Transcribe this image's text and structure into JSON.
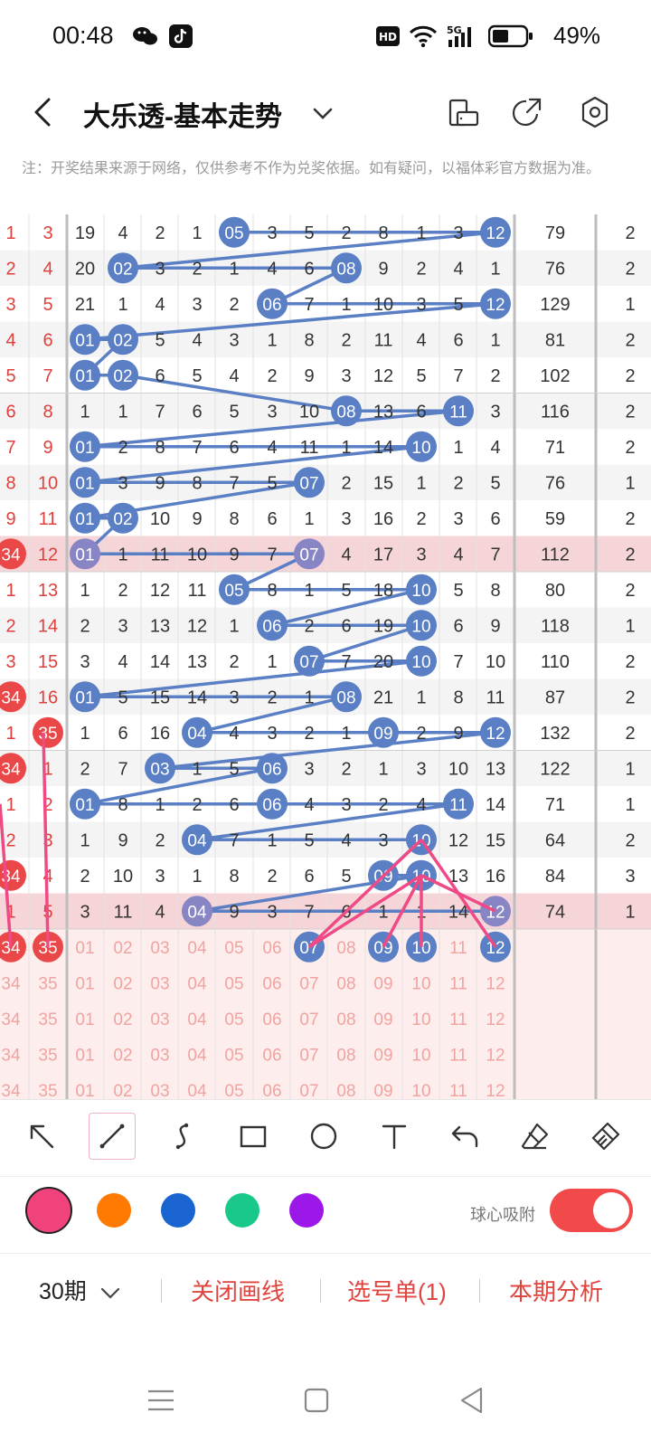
{
  "status": {
    "time": "00:48",
    "hd": "HD",
    "net": "5G",
    "battery": "49%"
  },
  "header": {
    "title": "大乐透-基本走势",
    "icons": [
      "chevron-down-icon",
      "phone-rotate-icon",
      "share-icon",
      "settings-icon"
    ]
  },
  "notice": "注：开奖结果来源于网络，仅供参考不作为兑奖依据。如有疑问，以福体彩官方数据为准。",
  "trend": {
    "rows": [
      [
        "1",
        "3",
        "19",
        "4",
        "2",
        "1",
        "05",
        "3",
        "5",
        "2",
        "8",
        "1",
        "3",
        "12",
        "79",
        "2"
      ],
      [
        "2",
        "4",
        "20",
        "02",
        "3",
        "2",
        "1",
        "4",
        "6",
        "08",
        "9",
        "2",
        "4",
        "1",
        "76",
        "2"
      ],
      [
        "3",
        "5",
        "21",
        "1",
        "4",
        "3",
        "2",
        "06",
        "7",
        "1",
        "10",
        "3",
        "5",
        "12",
        "129",
        "1"
      ],
      [
        "4",
        "6",
        "01",
        "02",
        "5",
        "4",
        "3",
        "1",
        "8",
        "2",
        "11",
        "4",
        "6",
        "1",
        "81",
        "2"
      ],
      [
        "5",
        "7",
        "01",
        "02",
        "6",
        "5",
        "4",
        "2",
        "9",
        "3",
        "12",
        "5",
        "7",
        "2",
        "102",
        "2"
      ],
      [
        "6",
        "8",
        "1",
        "1",
        "7",
        "6",
        "5",
        "3",
        "10",
        "08",
        "13",
        "6",
        "11",
        "3",
        "116",
        "2"
      ],
      [
        "7",
        "9",
        "01",
        "2",
        "8",
        "7",
        "6",
        "4",
        "11",
        "1",
        "14",
        "10",
        "1",
        "4",
        "71",
        "2"
      ],
      [
        "8",
        "10",
        "01",
        "3",
        "9",
        "8",
        "7",
        "5",
        "07",
        "2",
        "15",
        "1",
        "2",
        "5",
        "76",
        "1"
      ],
      [
        "9",
        "11",
        "01",
        "02",
        "10",
        "9",
        "8",
        "6",
        "1",
        "3",
        "16",
        "2",
        "3",
        "6",
        "59",
        "2"
      ],
      [
        "34",
        "12",
        "01",
        "1",
        "11",
        "10",
        "9",
        "7",
        "07",
        "4",
        "17",
        "3",
        "4",
        "7",
        "112",
        "2"
      ],
      [
        "1",
        "13",
        "1",
        "2",
        "12",
        "11",
        "05",
        "8",
        "1",
        "5",
        "18",
        "10",
        "5",
        "8",
        "80",
        "2"
      ],
      [
        "2",
        "14",
        "2",
        "3",
        "13",
        "12",
        "1",
        "06",
        "2",
        "6",
        "19",
        "10",
        "6",
        "9",
        "118",
        "1"
      ],
      [
        "3",
        "15",
        "3",
        "4",
        "14",
        "13",
        "2",
        "1",
        "07",
        "7",
        "20",
        "10",
        "7",
        "10",
        "110",
        "2"
      ],
      [
        "34",
        "16",
        "01",
        "5",
        "15",
        "14",
        "3",
        "2",
        "1",
        "08",
        "21",
        "1",
        "8",
        "11",
        "87",
        "2"
      ],
      [
        "1",
        "35",
        "1",
        "6",
        "16",
        "04",
        "4",
        "3",
        "2",
        "1",
        "09",
        "2",
        "9",
        "12",
        "132",
        "2"
      ],
      [
        "34",
        "1",
        "2",
        "7",
        "03",
        "1",
        "5",
        "06",
        "3",
        "2",
        "1",
        "3",
        "10",
        "13",
        "122",
        "1"
      ],
      [
        "1",
        "2",
        "01",
        "8",
        "1",
        "2",
        "6",
        "06",
        "4",
        "3",
        "2",
        "4",
        "11",
        "14",
        "71",
        "1"
      ],
      [
        "2",
        "3",
        "1",
        "9",
        "2",
        "04",
        "7",
        "1",
        "5",
        "4",
        "3",
        "10",
        "12",
        "15",
        "64",
        "2"
      ],
      [
        "34",
        "4",
        "2",
        "10",
        "3",
        "1",
        "8",
        "2",
        "6",
        "5",
        "09",
        "10",
        "13",
        "16",
        "84",
        "3"
      ],
      [
        "1",
        "5",
        "3",
        "11",
        "4",
        "04",
        "9",
        "3",
        "7",
        "6",
        "1",
        "1",
        "14",
        "12",
        "74",
        "1"
      ]
    ],
    "highlight_rows": [
      9,
      19
    ],
    "pick_rows": [
      [
        "34",
        "35",
        "01",
        "02",
        "03",
        "04",
        "05",
        "06",
        "07",
        "08",
        "09",
        "10",
        "11",
        "12"
      ],
      [
        "34",
        "35",
        "01",
        "02",
        "03",
        "04",
        "05",
        "06",
        "07",
        "08",
        "09",
        "10",
        "11",
        "12"
      ],
      [
        "34",
        "35",
        "01",
        "02",
        "03",
        "04",
        "05",
        "06",
        "07",
        "08",
        "09",
        "10",
        "11",
        "12"
      ],
      [
        "34",
        "35",
        "01",
        "02",
        "03",
        "04",
        "05",
        "06",
        "07",
        "08",
        "09",
        "10",
        "11",
        "12"
      ],
      [
        "34",
        "35",
        "01",
        "02",
        "03",
        "04",
        "05",
        "06",
        "07",
        "08",
        "09",
        "10",
        "11",
        "12"
      ]
    ],
    "selected": [
      "07",
      "09",
      "10",
      "12"
    ],
    "line_color": "#5a7fc4",
    "draw_color": "#ef4a86"
  },
  "tools": [
    "cursor-arrow-icon",
    "line-tool-icon",
    "curve-tool-icon",
    "rectangle-tool-icon",
    "circle-tool-icon",
    "text-tool-icon",
    "undo-icon",
    "eraser-icon",
    "clear-brush-icon"
  ],
  "colors": [
    "#f0437c",
    "#ff7a00",
    "#1a64d2",
    "#19c98a",
    "#9b18e8"
  ],
  "toggle": {
    "label": "球心吸附",
    "on": true
  },
  "actions": {
    "period": "30期",
    "close_lines": "关闭画线",
    "pick_list": "选号单(1)",
    "analysis": "本期分析"
  }
}
